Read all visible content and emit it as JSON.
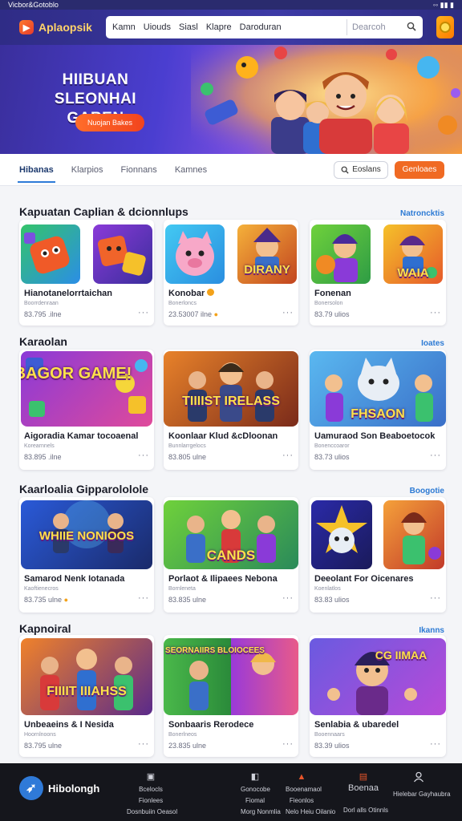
{
  "status_bar": {
    "left": "Vicbor&Gotoblo",
    "right": "◦◦ ▮▮ ▮"
  },
  "header": {
    "brand": "Aplaopsik",
    "search_tabs": [
      "Kamn",
      "Uiouds",
      "Siasl",
      "Klapre",
      "Daroduran"
    ],
    "search_placeholder": "Dearcoh"
  },
  "hero": {
    "title_line1": "HIIBUAN",
    "title_line2": "SLEONHAI GAREN",
    "button": "Nuojan Bakes"
  },
  "filters": {
    "tabs": [
      "Hibanas",
      "Klarpios",
      "Fionnans",
      "Kamnes"
    ],
    "search_button": "Eoslans",
    "cta_button": "Genloaes"
  },
  "sections": [
    {
      "title": "Kapuatan Caplian & dcionnlups",
      "link": "Natroncktis",
      "cards": [
        {
          "title": "Hianotanelorrtaichan",
          "sub": "Boorrdenraan",
          "meta": "83.795 .ilne"
        },
        {
          "title": "Konobar",
          "sub": "Bonerloncs",
          "meta": "23.53007 ilne"
        },
        {
          "title": "Fonenan",
          "sub": "Bonersolon",
          "meta": "83.79 ulios"
        }
      ],
      "thumb_labels": [
        "",
        "",
        "",
        "DIRANY",
        "",
        "WAIA"
      ]
    },
    {
      "title": "Karaolan",
      "link": "Ioates",
      "cards": [
        {
          "title": "Aigoradia Kamar tocoaenal",
          "sub": "Korearnnels",
          "meta": "83.895 .ilne"
        },
        {
          "title": "Koonlaar Klud &cDloonan",
          "sub": "Bunnlarrgelocs",
          "meta": "83.805 ulne"
        },
        {
          "title": "Uamuraod Son Beaboetocok",
          "sub": "Bonenccoaror",
          "meta": "83.73 ulios"
        }
      ],
      "thumb_labels": [
        "BAGOR GAME!",
        "TIIIIST IRELASS",
        "FHSAON"
      ]
    },
    {
      "title": "Kaarloalia Gipparololole",
      "link": "Boogotie",
      "cards": [
        {
          "title": "Samarod Nenk Iotanada",
          "sub": "Kaoftienecros",
          "meta": "83.735 ulne"
        },
        {
          "title": "Porlaot & Ilipaees Nebona",
          "sub": "Bornleneta",
          "meta": "83.835 ulne"
        },
        {
          "title": "Deeolant For Oicenares",
          "sub": "Koenlatlos",
          "meta": "83.83 ulios"
        }
      ],
      "thumb_labels": [
        "WHIIE NONIOOS",
        "CANDS",
        "",
        ""
      ]
    },
    {
      "title": "Kapnoiral",
      "link": "Ikanns",
      "cards": [
        {
          "title": "Unbeaeins & I Nesida",
          "sub": "Hoornlnoons",
          "meta": "83.795 ulne"
        },
        {
          "title": "Sonbaaris Rerodece",
          "sub": "Bonerlneos",
          "meta": "23.835 ulne"
        },
        {
          "title": "Senlabia & ubaredel",
          "sub": "Booennaars",
          "meta": "83.39 ulios"
        }
      ],
      "thumb_labels": [
        "FIIIIT IIIAHSS",
        "SEORNAIIRS BLOIOCEES",
        "CG IIMAA"
      ]
    }
  ],
  "bottom_nav": {
    "brand": "Hibolongh",
    "columns": [
      {
        "icon": "gamepad-icon",
        "lines": [
          "Bcelocls",
          "Fionlees",
          "Dosnbuiin Oeasol"
        ]
      },
      {
        "icon": "tablet-icon",
        "lines": [
          "Gonocobe",
          "Fiomal",
          "Morg Nonmlia"
        ]
      },
      {
        "icon": "fire-icon",
        "lines": [
          "Booenamaol",
          "Fieonlos",
          "Nelo Heiu Oilanio"
        ]
      },
      {
        "icon": "chat-icon",
        "lines": [
          "Boenaa",
          "",
          "Dorl alls Otinnls"
        ]
      },
      {
        "icon": "profile-icon",
        "lines": [
          "",
          "",
          "Hielebar Gayhaubra"
        ]
      }
    ]
  },
  "colors": {
    "accent": "#f06a23",
    "link": "#2c7ad4",
    "header": "#3c3aa6"
  }
}
